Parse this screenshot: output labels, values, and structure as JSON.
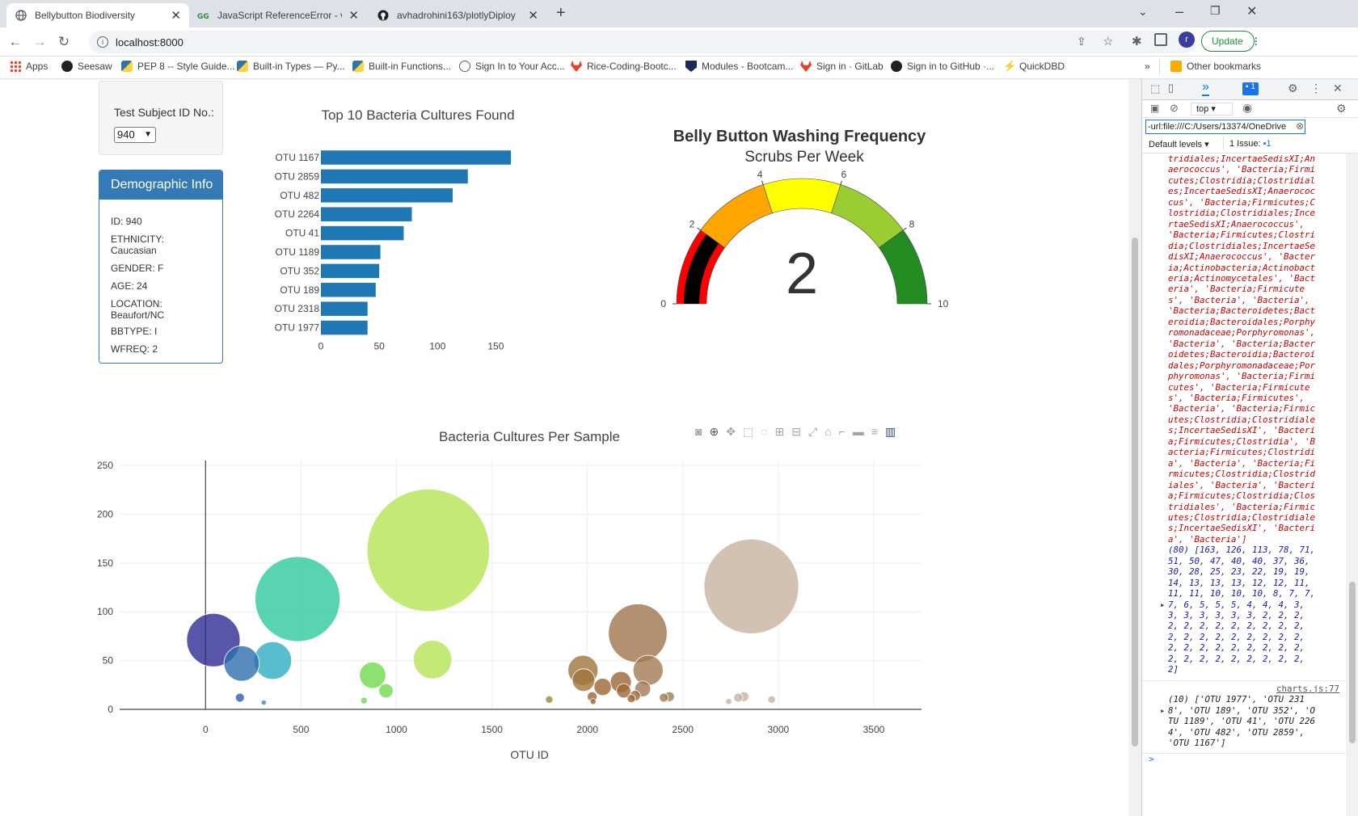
{
  "browser": {
    "tabs": [
      {
        "title": "Bellybutton Biodiversity",
        "active": true
      },
      {
        "title": "JavaScript ReferenceError - variab",
        "active": false
      },
      {
        "title": "avhadrohini163/plotlyDiploy",
        "active": false
      }
    ],
    "url": "localhost:8000",
    "update_label": "Update",
    "profile_initial": "r",
    "bookmarks": [
      "Apps",
      "Seesaw",
      "PEP 8 -- Style Guide...",
      "Built-in Types — Py...",
      "Built-in Functions...",
      "Sign In to Your Acc...",
      "Rice-Coding-Bootc...",
      "Modules - Bootcam...",
      "Sign in · GitLab",
      "Sign in to GitHub ·...",
      "QuickDBD"
    ],
    "bookmarks_more": "»",
    "other_bookmarks": "Other bookmarks"
  },
  "page": {
    "selector_label": "Test Subject ID No.:",
    "selected_id": "940",
    "demo_title": "Demographic Info",
    "demographics": [
      "ID: 940",
      "ETHNICITY: Caucasian",
      "GENDER: F",
      "AGE: 24",
      "LOCATION: Beaufort/NC",
      "BBTYPE: I",
      "WFREQ: 2"
    ]
  },
  "colors": {
    "bar": "#1f77b4",
    "demo_header": "#337ab7",
    "accent": "#1a73e8",
    "console_red": "#c80000",
    "console_blue": "#1a1aa6"
  },
  "chart_data": [
    {
      "type": "bar",
      "orientation": "horizontal",
      "title": "Top 10 Bacteria Cultures Found",
      "categories": [
        "OTU 1167",
        "OTU 2859",
        "OTU 482",
        "OTU 2264",
        "OTU 41",
        "OTU 1189",
        "OTU 352",
        "OTU 189",
        "OTU 2318",
        "OTU 1977"
      ],
      "values": [
        163,
        126,
        113,
        78,
        71,
        51,
        50,
        47,
        40,
        40
      ],
      "xlim": [
        0,
        165
      ],
      "xticks": [
        0,
        50,
        100,
        150
      ]
    },
    {
      "type": "gauge",
      "title": "Belly Button Washing Frequency",
      "subtitle": "Scrubs Per Week",
      "value": 2,
      "range": [
        0,
        10
      ],
      "ticks": [
        0,
        2,
        4,
        6,
        8,
        10
      ],
      "steps": [
        {
          "range": [
            0,
            2
          ],
          "color": "#ff0000"
        },
        {
          "range": [
            2,
            4
          ],
          "color": "#ffa500"
        },
        {
          "range": [
            4,
            6
          ],
          "color": "#ffff00"
        },
        {
          "range": [
            6,
            8
          ],
          "color": "#9acd32"
        },
        {
          "range": [
            8,
            10
          ],
          "color": "#228b22"
        }
      ],
      "bar_color": "#000000"
    },
    {
      "type": "scatter",
      "title": "Bacteria Cultures Per Sample",
      "xlabel": "OTU ID",
      "xlim": [
        -450,
        3750
      ],
      "ylim": [
        0,
        255
      ],
      "xticks": [
        0,
        500,
        1000,
        1500,
        2000,
        2500,
        3000,
        3500
      ],
      "yticks": [
        0,
        50,
        100,
        150,
        200,
        250
      ],
      "grid": true,
      "points": [
        {
          "x": 41,
          "y": 71,
          "color": "#2f2a95"
        },
        {
          "x": 189,
          "y": 47,
          "color": "#2e6fae"
        },
        {
          "x": 352,
          "y": 50,
          "color": "#2eaec3"
        },
        {
          "x": 482,
          "y": 113,
          "color": "#2ec99e"
        },
        {
          "x": 1167,
          "y": 163,
          "color": "#b5e455"
        },
        {
          "x": 1189,
          "y": 51,
          "color": "#b5e455"
        },
        {
          "x": 875,
          "y": 35,
          "color": "#6fd94e"
        },
        {
          "x": 945,
          "y": 19,
          "color": "#6fd94e"
        },
        {
          "x": 1977,
          "y": 40,
          "color": "#a0743c"
        },
        {
          "x": 1980,
          "y": 30,
          "color": "#a0743c"
        },
        {
          "x": 2080,
          "y": 23,
          "color": "#9c6634"
        },
        {
          "x": 2175,
          "y": 28,
          "color": "#9c6634"
        },
        {
          "x": 2190,
          "y": 19,
          "color": "#9c6634"
        },
        {
          "x": 2264,
          "y": 78,
          "color": "#9f764f"
        },
        {
          "x": 2318,
          "y": 40,
          "color": "#a27a55"
        },
        {
          "x": 2290,
          "y": 21,
          "color": "#a27a55"
        },
        {
          "x": 2859,
          "y": 126,
          "color": "#c8b29e"
        },
        {
          "x": 180,
          "y": 12,
          "color": "#2e5fa8"
        },
        {
          "x": 305,
          "y": 7,
          "color": "#2e8fb8"
        },
        {
          "x": 830,
          "y": 9,
          "color": "#6fd94e"
        },
        {
          "x": 1800,
          "y": 10,
          "color": "#9c8a40"
        },
        {
          "x": 2025,
          "y": 13,
          "color": "#9c6634"
        },
        {
          "x": 2030,
          "y": 8,
          "color": "#9c6634"
        },
        {
          "x": 2250,
          "y": 14,
          "color": "#9c6634"
        },
        {
          "x": 2230,
          "y": 11,
          "color": "#9c6634"
        },
        {
          "x": 2400,
          "y": 12,
          "color": "#a27a55"
        },
        {
          "x": 2430,
          "y": 13,
          "color": "#a27a55"
        },
        {
          "x": 2740,
          "y": 8,
          "color": "#c8b29e"
        },
        {
          "x": 2790,
          "y": 12,
          "color": "#c8b29e"
        },
        {
          "x": 2820,
          "y": 13,
          "color": "#c8b29e"
        },
        {
          "x": 2965,
          "y": 10,
          "color": "#c8b29e"
        }
      ]
    }
  ],
  "devtools": {
    "context": "top",
    "filter": "-url:file:///C:/Users/13374/OneDrive",
    "levels": "Default levels",
    "issues_label": "1 Issue:",
    "issues_count": "1",
    "badge_count": "1",
    "red_lines": [
      "tridiales;IncertaeSedisXI;An",
      "aerococcus', 'Bacteria;Firmi",
      "cutes;Clostridia;Clostridial",
      "es;IncertaeSedisXI;Anaerococ",
      "cus', 'Bacteria;Firmicutes;C",
      "lostridia;Clostridiales;Ince",
      "rtaeSedisXI;Anaerococcus',",
      "'Bacteria;Firmicutes;Clostri",
      "dia;Clostridiales;IncertaeSe",
      "disXI;Anaerococcus', 'Bacter",
      "ia;Actinobacteria;Actinobact",
      "eria;Actinomycetales', 'Bact",
      "eria', 'Bacteria;Firmicute",
      "s', 'Bacteria', 'Bacteria',",
      "'Bacteria;Bacteroidetes;Bact",
      "eroidia;Bacteroidales;Porphy",
      "romonadaceae;Porphyromonas',",
      "'Bacteria', 'Bacteria;Bacter",
      "oidetes;Bacteroidia;Bacteroi",
      "dales;Porphyromonadaceae;Por",
      "phyromonas', 'Bacteria;Firmi",
      "cutes', 'Bacteria;Firmicute",
      "s', 'Bacteria;Firmicutes',",
      "'Bacteria', 'Bacteria;Firmic",
      "utes;Clostridia;Clostridiale",
      "s;IncertaeSedisXI', 'Bacteri",
      "a;Firmicutes;Clostridia', 'B",
      "acteria;Firmicutes;Clostridi",
      "a', 'Bacteria', 'Bacteria;Fi",
      "rmicutes;Clostridia;Clostrid",
      "iales', 'Bacteria', 'Bacteri",
      "a;Firmicutes;Clostridia;Clos",
      "tridiales', 'Bacteria;Firmic",
      "utes;Clostridia;Clostridiale",
      "s;IncertaeSedisXI', 'Bacteri",
      "a', 'Bacteria']"
    ],
    "array_lines": [
      "(80) [163, 126, 113, 78, 71,",
      "51, 50, 47, 40, 40, 37, 36,",
      "30, 28, 25, 23, 22, 19, 19,",
      "14, 13, 13, 13, 12, 12, 11,",
      "11, 11, 10, 10, 10, 8, 7, 7,",
      "7, 6, 5, 5, 5, 4, 4, 4, 3,",
      "3, 3, 3, 3, 3, 3, 2, 2, 2,",
      "2, 2, 2, 2, 2, 2, 2, 2, 2,",
      "2, 2, 2, 2, 2, 2, 2, 2, 2,",
      "2, 2, 2, 2, 2, 2, 2, 2, 2,",
      "2, 2, 2, 2, 2, 2, 2, 2, 2,",
      "2]"
    ],
    "source_link": "charts.js:77",
    "otu_lines": [
      "(10) ['OTU 1977', 'OTU 231",
      "8', 'OTU 189', 'OTU 352', 'O",
      "TU 1189', 'OTU 41', 'OTU 226",
      "4', 'OTU 482', 'OTU 2859',",
      "'OTU 1167']"
    ],
    "prompt": ">"
  }
}
